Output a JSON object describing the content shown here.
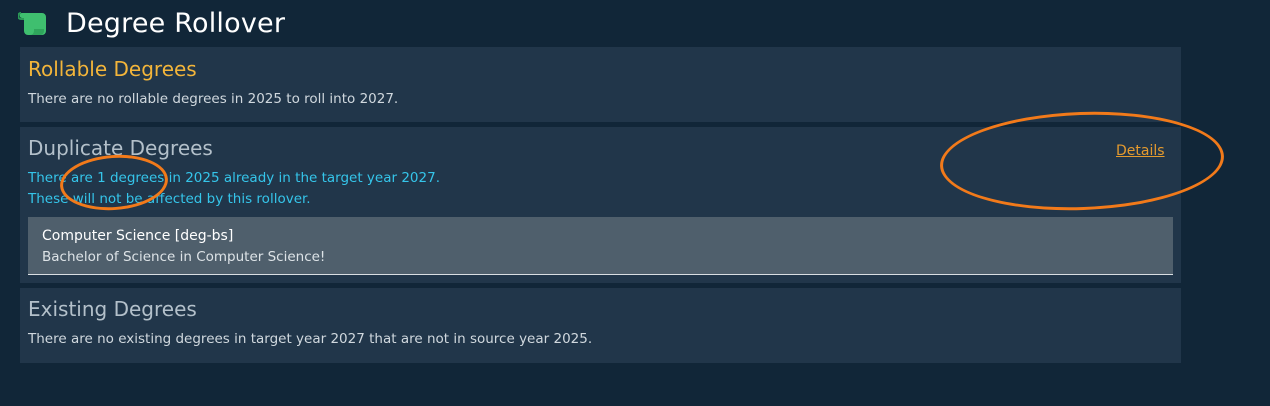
{
  "header": {
    "title": "Degree Rollover",
    "icon": "scroll-icon",
    "icon_color": "#3fbf6f"
  },
  "rollable": {
    "title": "Rollable Degrees",
    "message": "There are no rollable degrees in 2025 to roll into 2027."
  },
  "duplicate": {
    "title": "Duplicate Degrees",
    "details_label": "Details",
    "line1": "There are 1 degrees in 2025 already in the target year 2027.",
    "line2": "These will not be affected by this rollover.",
    "items": [
      {
        "name": "Computer Science [deg-bs]",
        "description": "Bachelor of Science in Computer Science!"
      }
    ]
  },
  "existing": {
    "title": "Existing Degrees",
    "message": "There are no existing degrees in target year 2027 that are not in source year 2025."
  },
  "colors": {
    "background": "#112638",
    "panel": "#21364a",
    "accent_yellow": "#f3b53a",
    "info_cyan": "#35c5ea",
    "link_orange": "#e49a2e",
    "annotation_orange": "#f27a1a"
  }
}
